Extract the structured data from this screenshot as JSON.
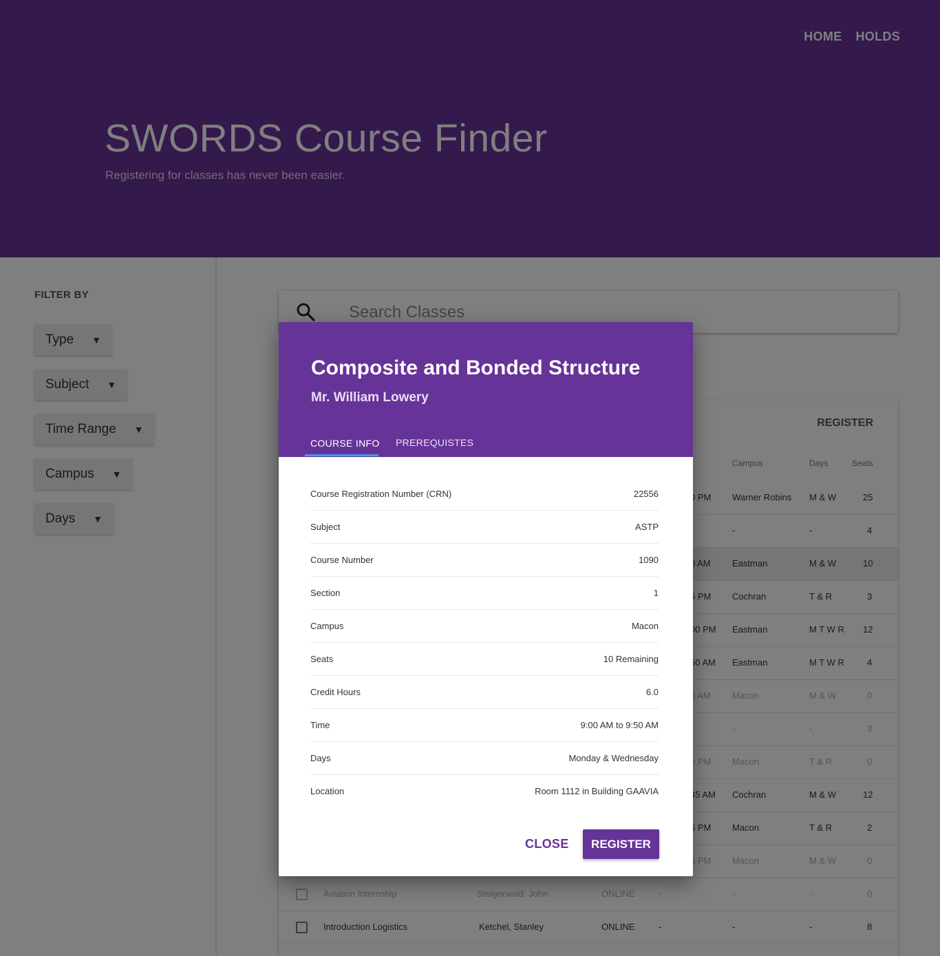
{
  "nav": {
    "home": "HOME",
    "holds": "HOLDS"
  },
  "hero": {
    "title": "SWORDS Course Finder",
    "subtitle": "Registering for classes has never been easier."
  },
  "filters": {
    "title": "FILTER BY",
    "items": [
      {
        "label": "Type"
      },
      {
        "label": "Subject"
      },
      {
        "label": "Time Range"
      },
      {
        "label": "Campus"
      },
      {
        "label": "Days"
      }
    ]
  },
  "search": {
    "placeholder": "Search Classes"
  },
  "table": {
    "register_label": "REGISTER",
    "headers": {
      "campus": "Campus",
      "days": "Days",
      "seats": "Seats"
    },
    "rows": [
      {
        "time": "0 PM",
        "campus": "Warner Robins",
        "days": "M & W",
        "seats": "25"
      },
      {
        "time": "",
        "campus": "-",
        "days": "-",
        "seats": "4"
      },
      {
        "time": "0 AM",
        "campus": "Eastman",
        "days": "M & W",
        "seats": "10"
      },
      {
        "time": "5 PM",
        "campus": "Cochran",
        "days": "T & R",
        "seats": "3"
      },
      {
        "time": "00 PM",
        "campus": "Eastman",
        "days": "M T W R",
        "seats": "12"
      },
      {
        "time": "50 AM",
        "campus": "Eastman",
        "days": "M T W R",
        "seats": "4"
      },
      {
        "time": "5 AM",
        "campus": "Macon",
        "days": "M & W",
        "seats": "0"
      },
      {
        "time": "",
        "campus": "-",
        "days": "-",
        "seats": "3"
      },
      {
        "time": "5 PM",
        "campus": "Macon",
        "days": "T & R",
        "seats": "0"
      },
      {
        "time": "45 AM",
        "campus": "Cochran",
        "days": "M & W",
        "seats": "12"
      },
      {
        "time": "5 PM",
        "campus": "Macon",
        "days": "T & R",
        "seats": "2"
      },
      {
        "time": "5 PM",
        "campus": "Macon",
        "days": "M & W",
        "seats": "0"
      }
    ],
    "full_rows": [
      {
        "title": "Aviation Internship",
        "instructor": "Steigerwald, John",
        "type": "ONLINE",
        "time": "-",
        "campus": "-",
        "days": "-",
        "seats": "0"
      },
      {
        "title": "Introduction Logistics",
        "instructor": "Ketchel, Stanley",
        "type": "ONLINE",
        "time": "-",
        "campus": "-",
        "days": "-",
        "seats": "8"
      }
    ]
  },
  "modal": {
    "title": "Composite and Bonded Structure",
    "instructor": "Mr. William Lowery",
    "tabs": {
      "info": "COURSE INFO",
      "prereq": "PREREQUISTES"
    },
    "info": [
      {
        "key": "Course Registration Number (CRN)",
        "value": "22556"
      },
      {
        "key": "Subject",
        "value": "ASTP"
      },
      {
        "key": "Course Number",
        "value": "1090"
      },
      {
        "key": "Section",
        "value": "1"
      },
      {
        "key": "Campus",
        "value": "Macon"
      },
      {
        "key": "Seats",
        "value": "10 Remaining"
      },
      {
        "key": "Credit Hours",
        "value": "6.0"
      },
      {
        "key": "Time",
        "value": "9:00 AM to 9:50 AM"
      },
      {
        "key": "Days",
        "value": "Monday & Wednesday"
      },
      {
        "key": "Location",
        "value": "Room 1112 in Building GAAVIA"
      }
    ],
    "close_label": "CLOSE",
    "register_label": "REGISTER"
  }
}
